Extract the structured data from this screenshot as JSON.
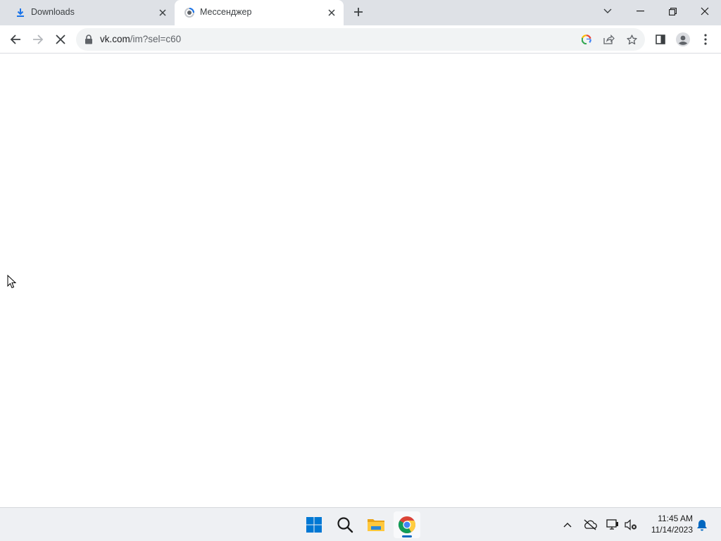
{
  "tabs": [
    {
      "label": "Downloads",
      "icon": "download-icon",
      "active": false
    },
    {
      "label": "Мессенджер",
      "icon": "vk-loading-icon",
      "active": true
    }
  ],
  "toolbar": {
    "url_domain": "vk.com",
    "url_path": "/im?sel=c60",
    "back_icon": "back-arrow-icon",
    "forward_icon": "forward-arrow-icon",
    "stop_icon": "stop-loading-icon"
  },
  "taskbar": {
    "apps": [
      "start-icon",
      "search-icon",
      "file-explorer-icon",
      "chrome-icon"
    ],
    "time": "11:45 AM",
    "date": "11/14/2023"
  },
  "colors": {
    "tabstrip": "#dee1e6",
    "accent": "#0067c0",
    "download_blue": "#1a73e8"
  }
}
